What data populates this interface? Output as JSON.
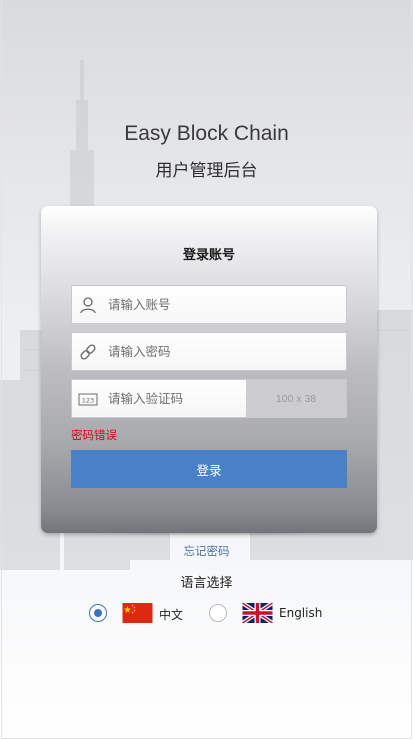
{
  "app": {
    "title": "Easy Block Chain",
    "subtitle": "用户管理后台"
  },
  "login": {
    "heading": "登录账号",
    "account_placeholder": "请输入账号",
    "password_placeholder": "请输入密码",
    "captcha_placeholder": "请输入验证码",
    "captcha_image_text": "100 x 38",
    "error_message": "密码错误",
    "submit_label": "登录",
    "forgot_password": "忘记密码"
  },
  "language": {
    "title": "语言选择",
    "options": [
      {
        "label": "中文",
        "selected": true,
        "flag": "china-flag"
      },
      {
        "label": "English",
        "selected": false,
        "flag": "uk-flag"
      }
    ]
  },
  "colors": {
    "primary_button": "#4a80c8",
    "error": "#e60012",
    "link": "#4a73a6",
    "radio_selected": "#3a73c4"
  },
  "icons": {
    "account": "user-icon",
    "password": "link-icon",
    "captcha": "code-icon"
  }
}
